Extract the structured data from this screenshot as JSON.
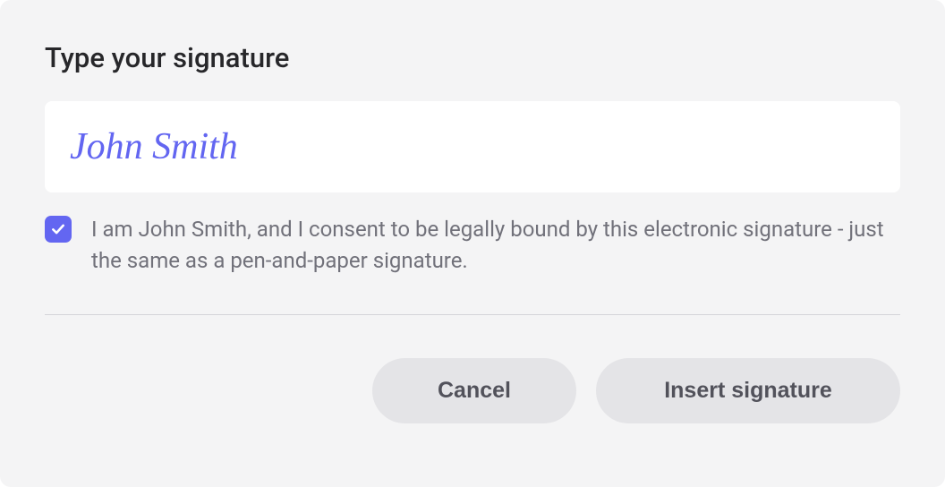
{
  "dialog": {
    "title": "Type your signature",
    "signature_value": "John Smith",
    "consent_checked": true,
    "consent_text": "I am John Smith, and I consent to be legally bound by this electronic signature - just the same as a pen-and-paper signature.",
    "cancel_label": "Cancel",
    "insert_label": "Insert signature"
  },
  "colors": {
    "accent": "#6366f1",
    "bg": "#f4f4f5",
    "input_bg": "#ffffff",
    "btn_bg": "#e4e4e7",
    "text_primary": "#27272a",
    "text_muted": "#71717a"
  }
}
